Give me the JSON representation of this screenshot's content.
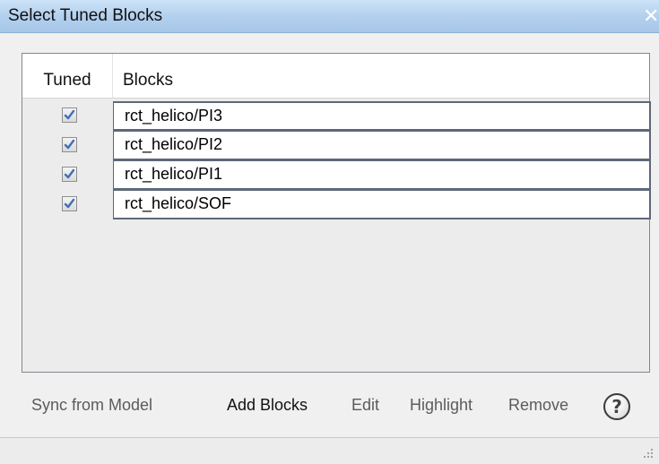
{
  "window": {
    "title": "Select Tuned Blocks",
    "close_glyph": "✕"
  },
  "table": {
    "columns": [
      "Tuned",
      "Blocks"
    ],
    "rows": [
      {
        "tuned": true,
        "block": "rct_helico/PI3"
      },
      {
        "tuned": true,
        "block": "rct_helico/PI2"
      },
      {
        "tuned": true,
        "block": "rct_helico/PI1"
      },
      {
        "tuned": true,
        "block": "rct_helico/SOF"
      }
    ]
  },
  "footer": {
    "sync_label": "Sync from Model",
    "add_label": "Add Blocks",
    "edit_label": "Edit",
    "highlight_label": "Highlight",
    "remove_label": "Remove",
    "help_glyph": "?"
  },
  "icons": {
    "check": "checkmark-icon",
    "help": "help-icon",
    "close": "close-icon",
    "grip": "resize-grip-icon"
  },
  "colors": {
    "titlebar": "#b3d0ee",
    "check": "#3e6fb8"
  }
}
